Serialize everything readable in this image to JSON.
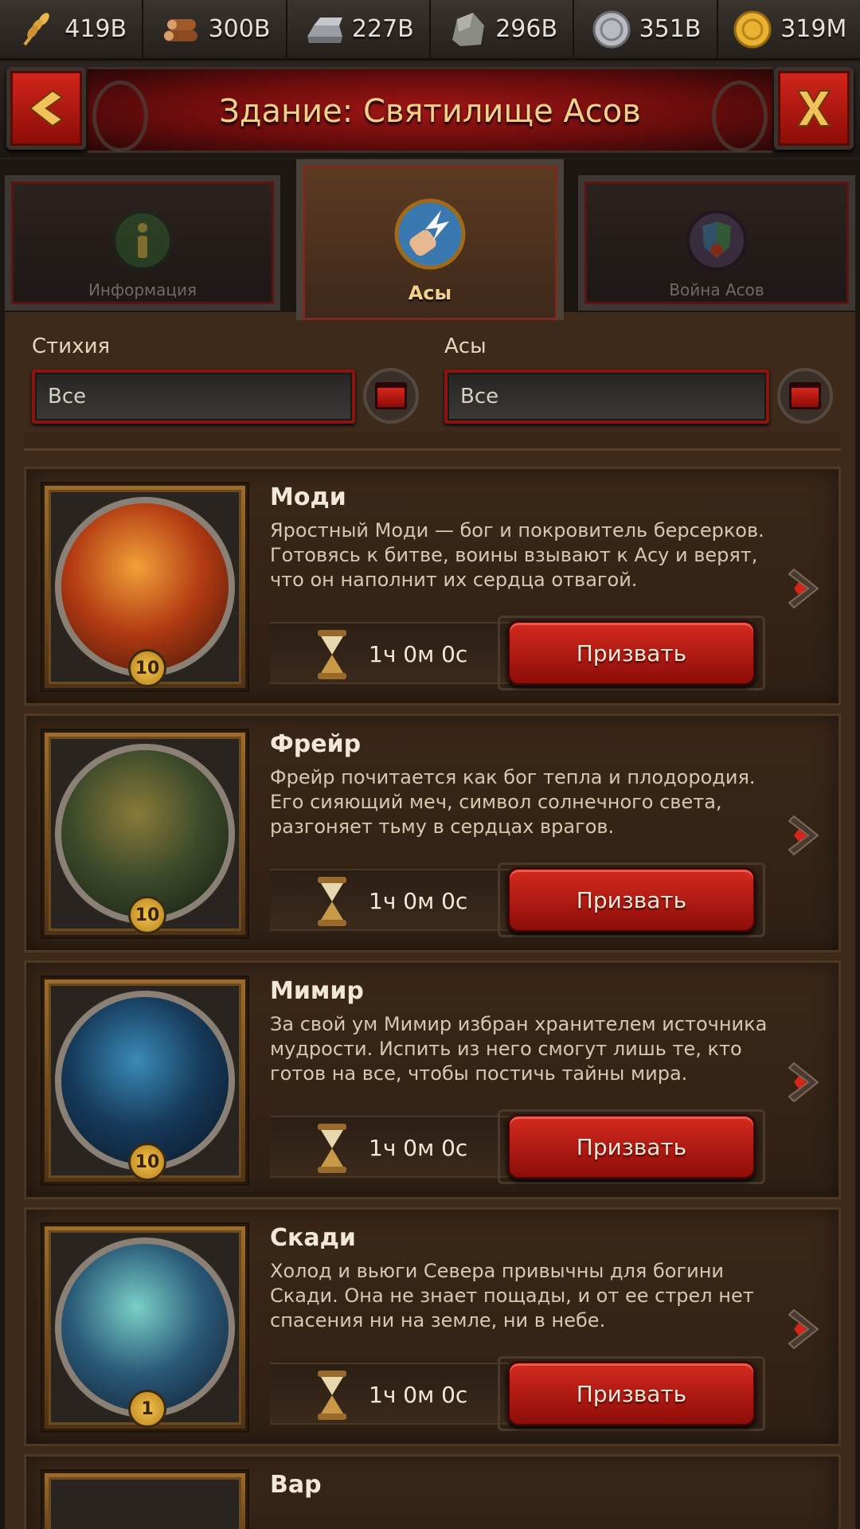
{
  "resources": [
    {
      "icon": "wheat-icon",
      "value": "419B"
    },
    {
      "icon": "wood-icon",
      "value": "300B"
    },
    {
      "icon": "iron-ingot-icon",
      "value": "227B"
    },
    {
      "icon": "stone-icon",
      "value": "296B"
    },
    {
      "icon": "silver-coin-icon",
      "value": "351B"
    },
    {
      "icon": "gold-coin-icon",
      "value": "319M"
    }
  ],
  "header": {
    "title": "Здание: Святилище Асов",
    "back_icon": "chevron-left-icon",
    "close_icon": "close-icon"
  },
  "tabs": [
    {
      "label": "Информация",
      "icon": "info-icon",
      "active": false
    },
    {
      "label": "Асы",
      "icon": "fist-lightning-icon",
      "active": true
    },
    {
      "label": "Война Асов",
      "icon": "war-shield-icon",
      "active": false
    }
  ],
  "filters": {
    "element": {
      "label": "Стихия",
      "value": "Все"
    },
    "gods": {
      "label": "Асы",
      "value": "Все"
    }
  },
  "cards": [
    {
      "name": "Моди",
      "description": "Яростный Моди — бог и покровитель берсерков. Готовясь к битве, воины взывают к Асу и верят, что он наполнит их сердца отвагой.",
      "level": "10",
      "time": "1ч 0м 0с",
      "button": "Призвать",
      "colors": [
        "#f1a13a",
        "#b23a12",
        "#3a1308"
      ]
    },
    {
      "name": "Фрейр",
      "description": "Фрейр почитается как бог тепла и плодородия. Его сияющий меч, символ солнечного света, разгоняет тьму в сердцах врагов.",
      "level": "10",
      "time": "1ч 0м 0с",
      "button": "Призвать",
      "colors": [
        "#8a7a3a",
        "#3c4a2a",
        "#121a10"
      ]
    },
    {
      "name": "Мимир",
      "description": "За свой ум Мимир избран хранителем источника мудрости. Испить из него смогут лишь те, кто готов на все, чтобы постичь тайны мира.",
      "level": "10",
      "time": "1ч 0м 0с",
      "button": "Призвать",
      "colors": [
        "#3a8ab8",
        "#163a5a",
        "#0a1420"
      ]
    },
    {
      "name": "Скади",
      "description": "Холод и вьюги Севера привычны для богини Скади. Она не знает пощады, и от ее стрел нет спасения ни на земле, ни в небе.",
      "level": "1",
      "time": "1ч 0м 0с",
      "button": "Призвать",
      "colors": [
        "#7ad0c8",
        "#2a5a78",
        "#0e1a2a"
      ]
    }
  ],
  "next_card": {
    "name": "Вар"
  }
}
